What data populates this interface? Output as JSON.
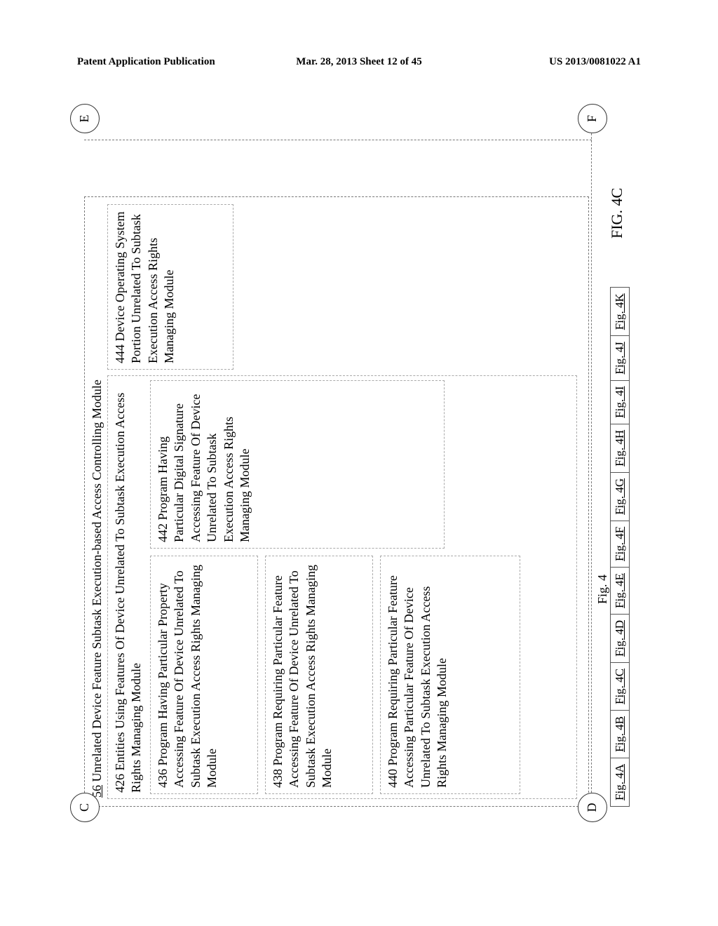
{
  "header": {
    "left": "Patent Application Publication",
    "center": "Mar. 28, 2013  Sheet 12 of 45",
    "right": "US 2013/0081022 A1"
  },
  "connectors": {
    "c": "C",
    "d": "D",
    "e": "E",
    "f": "F"
  },
  "module56": {
    "number": "56",
    "title": "Unrelated Device Feature Subtask Execution-based Access Controlling Module"
  },
  "box426": "426 Entities Using Features Of Device Unrelated To Subtask Execution Access Rights Managing Module",
  "box436": "436 Program Having Particular Property Accessing Feature Of Device Unrelated To Subtask Execution Access Rights Managing Module",
  "box438": "438 Program Requiring Particular Feature Accessing Feature Of Device Unrelated To Subtask Execution Access Rights Managing Module",
  "box440": "440 Program Requiring Particular Feature Accessing Particular Feature Of Device Unrelated To Subtask Execution Access Rights Managing Module",
  "box442": "442 Program Having Particular Digital Signature Accessing Feature Of Device Unrelated To Subtask Execution Access Rights Managing Module",
  "box444": "444 Device Operating System Portion Unrelated To Subtask Execution Access Rights Managing Module",
  "figLabel": "Fig. 4",
  "figBig": "FIG. 4C",
  "nav": [
    "Fig. 4A",
    "Fig. 4B",
    "Fig. 4C",
    "Fig. 4D",
    "Fig. 4E",
    "Fig. 4F",
    "Fig. 4G",
    "Fig. 4H",
    "Fig. 4I",
    "Fig. 4J",
    "Fig. 4K"
  ]
}
